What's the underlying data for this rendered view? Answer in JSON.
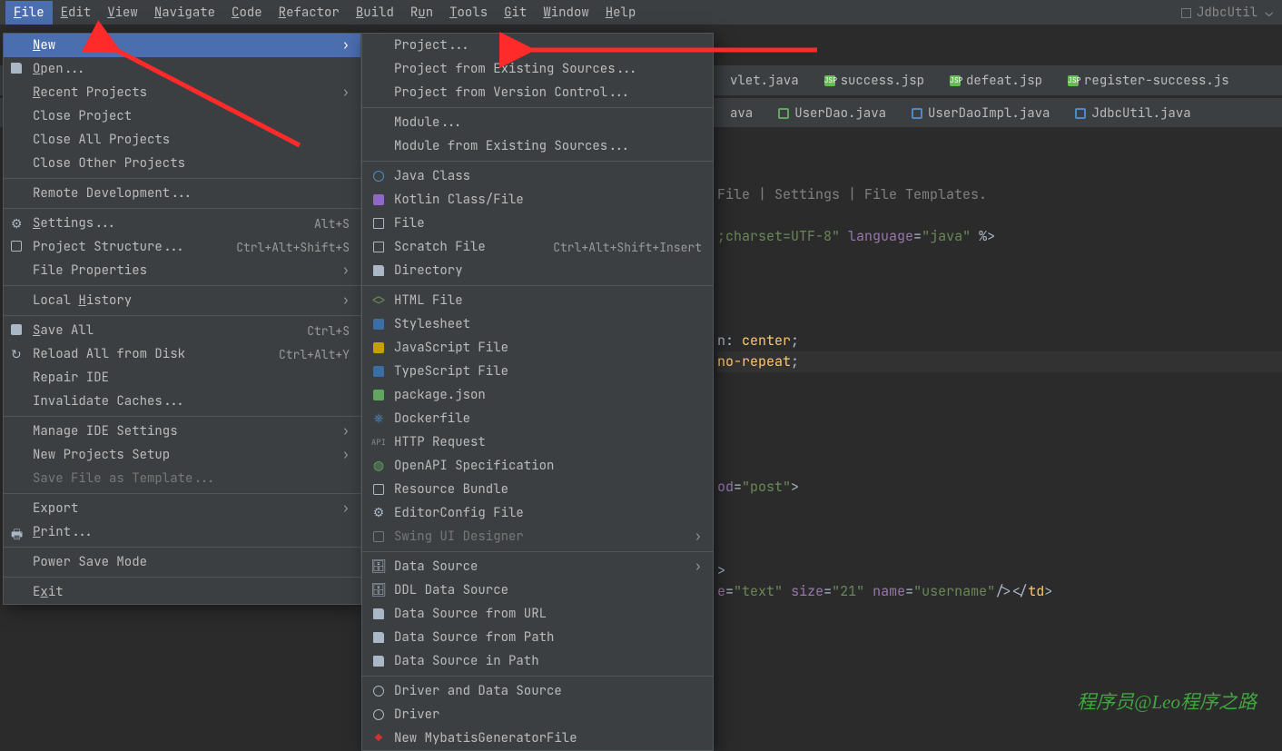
{
  "menubar": {
    "items": [
      {
        "label": "File",
        "mn": "F"
      },
      {
        "label": "Edit",
        "mn": "E"
      },
      {
        "label": "View",
        "mn": "V"
      },
      {
        "label": "Navigate",
        "mn": "N"
      },
      {
        "label": "Code",
        "mn": "C"
      },
      {
        "label": "Refactor",
        "mn": "R"
      },
      {
        "label": "Build",
        "mn": "B"
      },
      {
        "label": "Run",
        "mn": "u"
      },
      {
        "label": "Tools",
        "mn": "T"
      },
      {
        "label": "Git",
        "mn": "G"
      },
      {
        "label": "Window",
        "mn": "W"
      },
      {
        "label": "Help",
        "mn": "H"
      }
    ],
    "right_label": "JdbcUtil"
  },
  "tabs_row1": [
    {
      "label": "vlet.java"
    },
    {
      "label": "success.jsp",
      "icon": "jsp"
    },
    {
      "label": "defeat.jsp",
      "icon": "jsp"
    },
    {
      "label": "register-success.js",
      "icon": "jsp"
    }
  ],
  "tabs_row2": [
    {
      "label": "ava"
    },
    {
      "label": "UserDao.java",
      "icon": "i"
    },
    {
      "label": "UserDaoImpl.java",
      "icon": "c"
    },
    {
      "label": "JdbcUtil.java",
      "icon": "c"
    }
  ],
  "file_menu": [
    {
      "type": "item",
      "label": "New",
      "mn": "N",
      "submenu": true,
      "highlight": true
    },
    {
      "type": "item",
      "label": "Open...",
      "mn": "O",
      "icon": "folder"
    },
    {
      "type": "item",
      "label": "Recent Projects",
      "mn": "R",
      "submenu": true
    },
    {
      "type": "item",
      "label": "Close Project"
    },
    {
      "type": "item",
      "label": "Close All Projects"
    },
    {
      "type": "item",
      "label": "Close Other Projects"
    },
    {
      "type": "sep"
    },
    {
      "type": "item",
      "label": "Remote Development..."
    },
    {
      "type": "sep"
    },
    {
      "type": "item",
      "label": "Settings...",
      "mn": "S",
      "icon": "gear",
      "shortcut": "Alt+S"
    },
    {
      "type": "item",
      "label": "Project Structure...",
      "icon": "structure",
      "shortcut": "Ctrl+Alt+Shift+S"
    },
    {
      "type": "item",
      "label": "File Properties",
      "submenu": true
    },
    {
      "type": "sep"
    },
    {
      "type": "item",
      "label": "Local History",
      "mn": "H",
      "submenu": true
    },
    {
      "type": "sep"
    },
    {
      "type": "item",
      "label": "Save All",
      "mn": "S",
      "icon": "save",
      "shortcut": "Ctrl+S"
    },
    {
      "type": "item",
      "label": "Reload All from Disk",
      "icon": "reload",
      "shortcut": "Ctrl+Alt+Y"
    },
    {
      "type": "item",
      "label": "Repair IDE"
    },
    {
      "type": "item",
      "label": "Invalidate Caches..."
    },
    {
      "type": "sep"
    },
    {
      "type": "item",
      "label": "Manage IDE Settings",
      "submenu": true
    },
    {
      "type": "item",
      "label": "New Projects Setup",
      "submenu": true
    },
    {
      "type": "item",
      "label": "Save File as Template...",
      "disabled": true
    },
    {
      "type": "sep"
    },
    {
      "type": "item",
      "label": "Export",
      "submenu": true
    },
    {
      "type": "item",
      "label": "Print...",
      "mn": "P",
      "icon": "print"
    },
    {
      "type": "sep"
    },
    {
      "type": "item",
      "label": "Power Save Mode"
    },
    {
      "type": "sep"
    },
    {
      "type": "item",
      "label": "Exit",
      "mn": "x"
    }
  ],
  "new_menu": [
    {
      "type": "item",
      "label": "Project..."
    },
    {
      "type": "item",
      "label": "Project from Existing Sources..."
    },
    {
      "type": "item",
      "label": "Project from Version Control..."
    },
    {
      "type": "sep"
    },
    {
      "type": "item",
      "label": "Module..."
    },
    {
      "type": "item",
      "label": "Module from Existing Sources..."
    },
    {
      "type": "sep"
    },
    {
      "type": "item",
      "label": "Java Class",
      "icon": "circle-blue"
    },
    {
      "type": "item",
      "label": "Kotlin Class/File",
      "icon": "sq-purple"
    },
    {
      "type": "item",
      "label": "File",
      "icon": "file"
    },
    {
      "type": "item",
      "label": "Scratch File",
      "icon": "file",
      "shortcut": "Ctrl+Alt+Shift+Insert"
    },
    {
      "type": "item",
      "label": "Directory",
      "icon": "folder"
    },
    {
      "type": "sep"
    },
    {
      "type": "item",
      "label": "HTML File",
      "icon": "html"
    },
    {
      "type": "item",
      "label": "Stylesheet",
      "icon": "sq-blue"
    },
    {
      "type": "item",
      "label": "JavaScript File",
      "icon": "sq-yellow"
    },
    {
      "type": "item",
      "label": "TypeScript File",
      "icon": "sq-blue"
    },
    {
      "type": "item",
      "label": "package.json",
      "icon": "sq-green"
    },
    {
      "type": "item",
      "label": "Dockerfile",
      "icon": "docker"
    },
    {
      "type": "item",
      "label": "HTTP Request",
      "icon": "api"
    },
    {
      "type": "item",
      "label": "OpenAPI Specification",
      "icon": "globe"
    },
    {
      "type": "item",
      "label": "Resource Bundle",
      "icon": "bundle"
    },
    {
      "type": "item",
      "label": "EditorConfig File",
      "icon": "gear"
    },
    {
      "type": "item",
      "label": "Swing UI Designer",
      "icon": "swing",
      "arrow": true,
      "disabled": true
    },
    {
      "type": "sep"
    },
    {
      "type": "item",
      "label": "Data Source",
      "icon": "db",
      "arrow": true
    },
    {
      "type": "item",
      "label": "DDL Data Source",
      "icon": "db"
    },
    {
      "type": "item",
      "label": "Data Source from URL",
      "icon": "folder"
    },
    {
      "type": "item",
      "label": "Data Source from Path",
      "icon": "folder"
    },
    {
      "type": "item",
      "label": "Data Source in Path",
      "icon": "folder"
    },
    {
      "type": "sep"
    },
    {
      "type": "item",
      "label": "Driver and Data Source",
      "icon": "driver"
    },
    {
      "type": "item",
      "label": "Driver",
      "icon": "driver"
    },
    {
      "type": "item",
      "label": "New MybatisGeneratorFile",
      "icon": "mybatis"
    }
  ],
  "editor_lines": [
    "File | Settings | File Templates.",
    "",
    ";charset=UTF-8\" language=\"java\" %>",
    "",
    "",
    "",
    "",
    "",
    ": center;",
    "no-repeat;",
    "",
    "",
    "",
    "",
    "",
    "",
    "d=\"post\">",
    "",
    "",
    "",
    ">",
    "e=\"text\" size=\"21\" name=\"username\"/></td>"
  ],
  "watermark": "程序员@Leo程序之路"
}
